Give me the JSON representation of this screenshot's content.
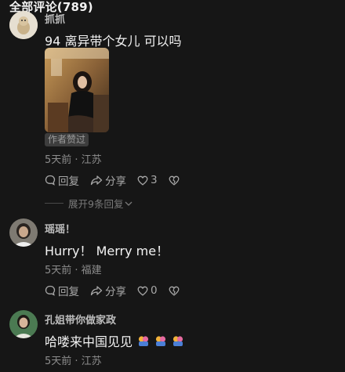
{
  "header": {
    "title": "全部评论(789)"
  },
  "comments": [
    {
      "username": "抓抓",
      "text": "94 离异带个女儿 可以吗",
      "author_badge": "作者赞过",
      "meta": "5天前 · 江苏",
      "reply_label": "回复",
      "share_label": "分享",
      "like_count": "3",
      "expand_label": "展开9条回复"
    },
    {
      "username": "瑶瑶！",
      "text": "Hurry！ Merry me！",
      "meta": "5天前 · 福建",
      "reply_label": "回复",
      "share_label": "分享",
      "like_count": "0"
    },
    {
      "username": "孔姐带你做家政",
      "text": "哈喽来中国见见",
      "meta": "5天前 · 江苏"
    }
  ],
  "icons": {
    "reply": "speech-bubble-icon",
    "share": "share-arrow-icon",
    "like": "heart-icon",
    "dislike": "broken-heart-icon",
    "expand": "chevron-down-icon",
    "emoji": "hugging-emoji-icon"
  },
  "colors": {
    "background": "#161616",
    "text": "#f3f3f3",
    "meta": "#8d8d8d"
  }
}
